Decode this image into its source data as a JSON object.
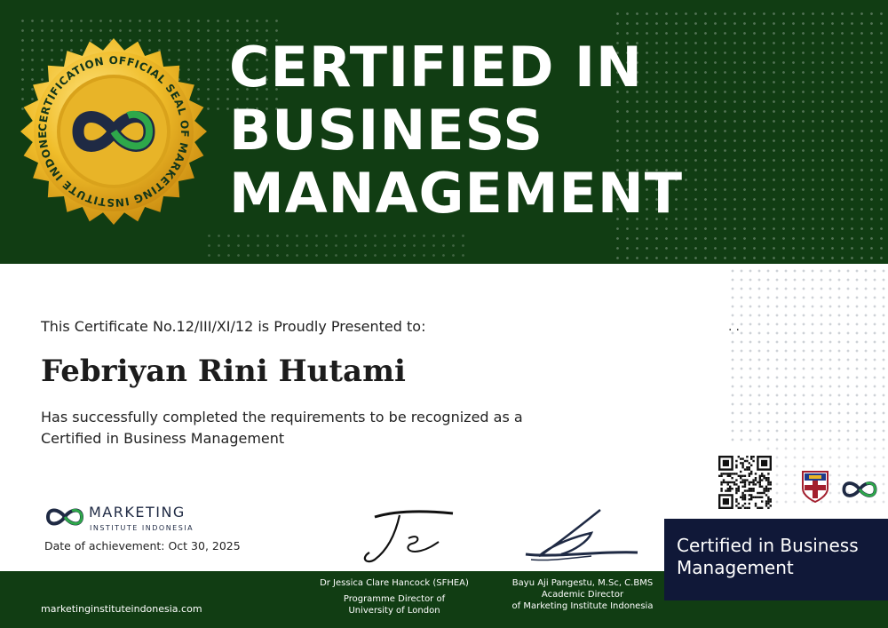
{
  "seal": {
    "ring_text": "CERTIFICATION OFFICIAL SEAL OF MARKETING INSTITUTE INDONESIA",
    "icon": "infinity-icon"
  },
  "header": {
    "title_lines": [
      "CERTIFIED IN",
      "BUSINESS",
      "MANAGEMENT"
    ]
  },
  "certificate": {
    "presented_text": "This Certificate No.12/III/XI/12 is Proudly Presented to:",
    "recipient": "Febriyan Rini Hutami",
    "description_lines": [
      "Has successfully completed the requirements to be recognized as a",
      "Certified in Business Management"
    ]
  },
  "issuer": {
    "logo_line1": "MARKETING",
    "logo_line2": "INSTITUTE INDONESIA",
    "achievement": "Date of achievement: Oct 30, 2025"
  },
  "signatories": [
    {
      "name": "Dr Jessica Clare Hancock (SFHEA)",
      "role": "Programme Director of",
      "org": "University of London"
    },
    {
      "name": "Bayu Aji Pangestu, M.Sc, C.BMS",
      "role": "Academic Director",
      "org": "of Marketing Institute Indonesia"
    }
  ],
  "badge": {
    "text_lines": [
      "Certified in Business",
      "Management"
    ]
  },
  "footer": {
    "website": "marketinginstituteindonesia.com"
  },
  "colors": {
    "header_green": "#113d13",
    "navy": "#101838",
    "gold": "#e9b526"
  }
}
